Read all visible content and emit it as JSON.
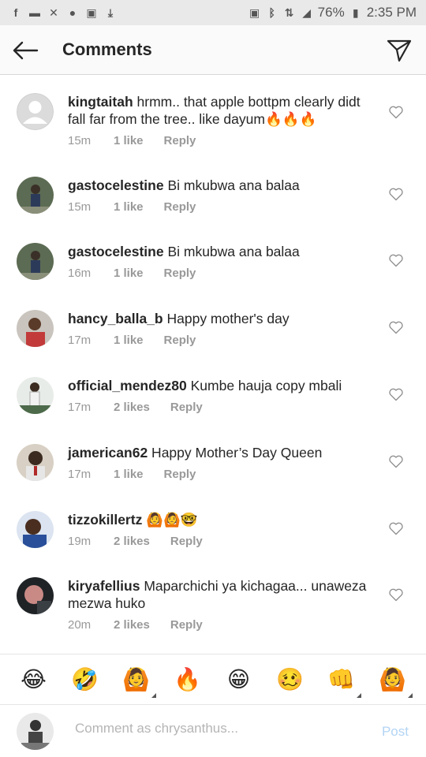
{
  "status_bar": {
    "battery": "76%",
    "time": "2:35 PM"
  },
  "header": {
    "title": "Comments"
  },
  "comments": [
    {
      "user": "kingtaitah",
      "text": " hrmm.. that apple bottpm clearly didt fall far from the tree.. like dayum🔥🔥🔥",
      "time": "15m",
      "likes": "1 like",
      "reply": "Reply"
    },
    {
      "user": "gastocelestine",
      "text": " Bi mkubwa ana balaa",
      "time": "15m",
      "likes": "1 like",
      "reply": "Reply"
    },
    {
      "user": "gastocelestine",
      "text": " Bi mkubwa ana balaa",
      "time": "16m",
      "likes": "1 like",
      "reply": "Reply"
    },
    {
      "user": "hancy_balla_b",
      "text": " Happy mother's day",
      "time": "17m",
      "likes": "1 like",
      "reply": "Reply"
    },
    {
      "user": "official_mendez80",
      "text": " Kumbe hauja copy mbali",
      "time": "17m",
      "likes": "2 likes",
      "reply": "Reply"
    },
    {
      "user": "jamerican62",
      "text": " Happy Mother’s Day Queen",
      "time": "17m",
      "likes": "1 like",
      "reply": "Reply"
    },
    {
      "user": "tizzokillertz",
      "text": " 🙆🙆🤓",
      "time": "19m",
      "likes": "2 likes",
      "reply": "Reply"
    },
    {
      "user": "kiryafellius",
      "text": " Maparchichi ya kichagaa... unaweza mezwa huko",
      "time": "20m",
      "likes": "2 likes",
      "reply": "Reply"
    }
  ],
  "emoji_bar": [
    "😂",
    "🤣",
    "🙆",
    "🔥",
    "😁",
    "🥴",
    "👊",
    "🙆"
  ],
  "input": {
    "placeholder": "Comment as chrysanthus...",
    "post_label": "Post"
  },
  "colors": {
    "status_bg": "#e9e9e9",
    "header_bg": "#fafafa",
    "meta_gray": "#999999",
    "post_blue": "#b3d4f5"
  }
}
